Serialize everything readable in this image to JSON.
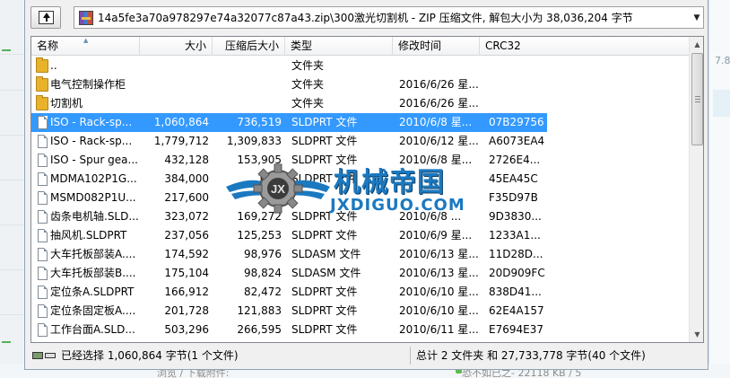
{
  "background": {
    "right_value": "7.8",
    "bottom_left_text": "浏览 / 下载附件:",
    "bottom_right_text": "恐不如已之- 22118 KB / 5"
  },
  "address": {
    "path": "14a5fe3a70a978297e74a32077c87a43.zip\\300激光切割机 - ZIP 压缩文件, 解包大小为 38,036,204 字节"
  },
  "columns": {
    "name": "名称",
    "size": "大小",
    "packed": "压缩后大小",
    "type": "类型",
    "modified": "修改时间",
    "crc": "CRC32"
  },
  "rows": [
    {
      "icon": "folder",
      "name": "..",
      "size": "",
      "packed": "",
      "type": "文件夹",
      "modified": "",
      "crc": ""
    },
    {
      "icon": "folder",
      "name": "电气控制操作柜",
      "size": "",
      "packed": "",
      "type": "文件夹",
      "modified": "2016/6/26 星...",
      "crc": ""
    },
    {
      "icon": "folder",
      "name": "切割机",
      "size": "",
      "packed": "",
      "type": "文件夹",
      "modified": "2016/6/26 星...",
      "crc": ""
    },
    {
      "icon": "file",
      "name": "ISO - Rack-sp...",
      "size": "1,060,864",
      "packed": "736,519",
      "type": "SLDPRT 文件",
      "modified": "2010/6/8 星...",
      "crc": "07B29756",
      "selected": true
    },
    {
      "icon": "file",
      "name": "ISO - Rack-sp...",
      "size": "1,779,712",
      "packed": "1,309,833",
      "type": "SLDPRT 文件",
      "modified": "2010/6/12 星...",
      "crc": "A6073EA4"
    },
    {
      "icon": "file",
      "name": "ISO - Spur gea...",
      "size": "432,128",
      "packed": "153,905",
      "type": "SLDPRT 文件",
      "modified": "2010/6/8 星...",
      "crc": "2726E4..."
    },
    {
      "icon": "file",
      "name": "MDMA102P1G...",
      "size": "384,000",
      "packed": "15...",
      "type": "SLDPRT 文件",
      "modified": "",
      "crc": "45EA45C"
    },
    {
      "icon": "file",
      "name": "MSMD082P1U...",
      "size": "217,600",
      "packed": "",
      "type": "",
      "modified": "",
      "crc": "F35D97B"
    },
    {
      "icon": "file",
      "name": "齿条电机轴.SLD...",
      "size": "323,072",
      "packed": "169,272",
      "type": "SLDPRT 文件",
      "modified": "2010/6/8 ...",
      "crc": "9D3830..."
    },
    {
      "icon": "file",
      "name": "抽风机.SLDPRT",
      "size": "237,056",
      "packed": "125,253",
      "type": "SLDPRT 文件",
      "modified": "2010/6/9 星...",
      "crc": "1233A1..."
    },
    {
      "icon": "file",
      "name": "大车托板部装A....",
      "size": "174,592",
      "packed": "98,976",
      "type": "SLDASM 文件",
      "modified": "2010/6/13 星...",
      "crc": "11D28D..."
    },
    {
      "icon": "file",
      "name": "大车托板部装B....",
      "size": "175,104",
      "packed": "98,824",
      "type": "SLDASM 文件",
      "modified": "2010/6/13 星...",
      "crc": "20D909FC"
    },
    {
      "icon": "file",
      "name": "定位条A.SLDPRT",
      "size": "166,912",
      "packed": "82,472",
      "type": "SLDPRT 文件",
      "modified": "2010/6/10 星...",
      "crc": "838D41..."
    },
    {
      "icon": "file",
      "name": "定位条固定板A....",
      "size": "201,728",
      "packed": "121,883",
      "type": "SLDPRT 文件",
      "modified": "2010/6/10 星...",
      "crc": "62E4A157"
    },
    {
      "icon": "file",
      "name": "工作台面A.SLD...",
      "size": "503,296",
      "packed": "266,595",
      "type": "SLDPRT 文件",
      "modified": "2010/6/11 星...",
      "crc": "E7694E37"
    }
  ],
  "status": {
    "selected": "已经选择 1,060,864 字节(1 个文件)",
    "total": "总计 2 文件夹 和 27,733,778 字节(40 个文件)"
  },
  "watermark": {
    "cn": "机械帝国",
    "en": "JXDIGUO.COM"
  },
  "colors": {
    "selection": "#3399ff",
    "watermark": "#1b79c0"
  }
}
